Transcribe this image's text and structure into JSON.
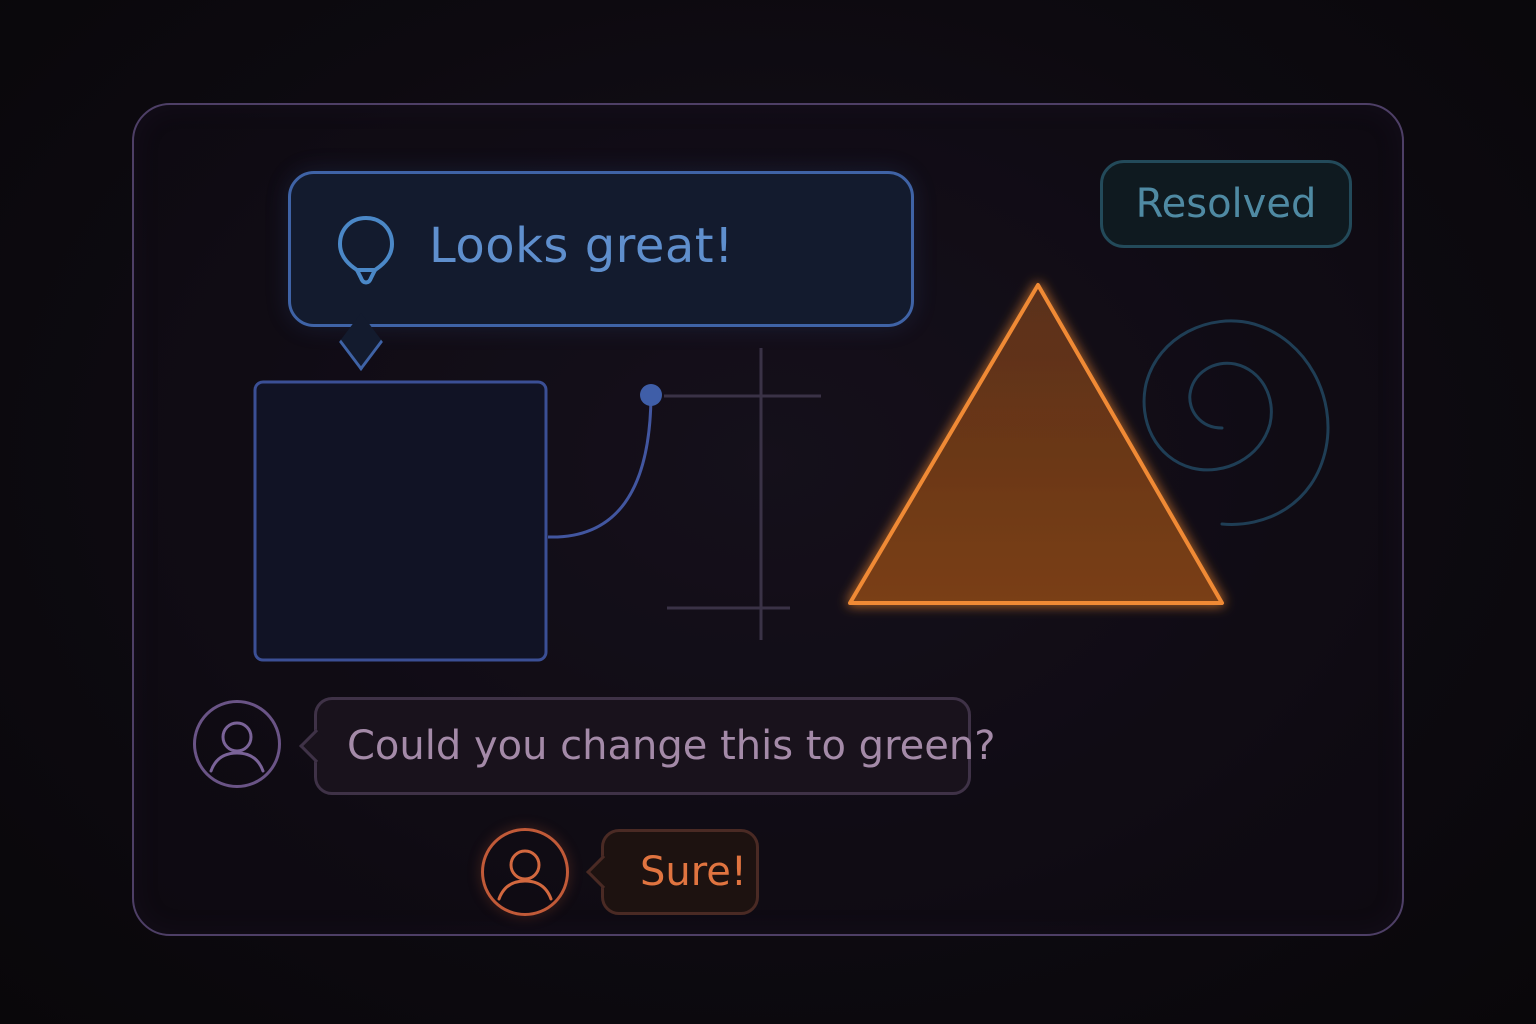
{
  "canvas": {
    "main_comment": {
      "text": "Looks great!",
      "icon": "pin-icon"
    },
    "status_badge": {
      "label": "Resolved"
    },
    "shapes": {
      "rectangle": "rectangle-shape",
      "triangle": "triangle-shape",
      "spiral": "spiral-shape",
      "crosshair": "crosshair-guides"
    }
  },
  "thread": [
    {
      "avatar_icon": "user-icon",
      "text": "Could you change this to green?"
    },
    {
      "avatar_icon": "user-icon",
      "text": "Sure!"
    }
  ],
  "colors": {
    "frame": "#4e3f66",
    "comment_blue": "#3f63a6",
    "resolved": "#4f8aa3",
    "triangle_stroke": "#f08a35",
    "triangle_fill": "#6b3818",
    "reply_orange": "#e07440",
    "comment_purple": "#a48aa8"
  }
}
